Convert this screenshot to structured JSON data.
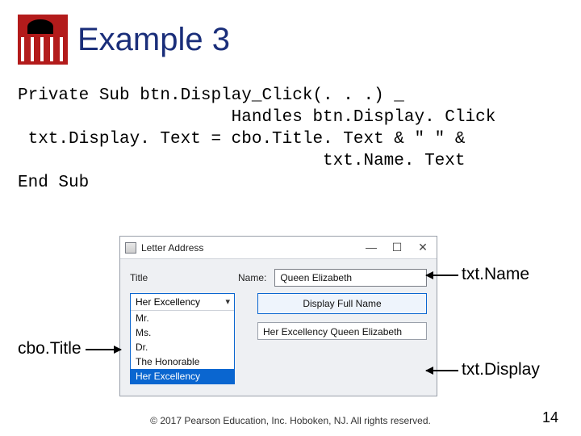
{
  "slide": {
    "title": "Example 3",
    "code": "Private Sub btn.Display_Click(. . .) _\n                     Handles btn.Display. Click\n txt.Display. Text = cbo.Title. Text & \" \" &\n                              txt.Name. Text\nEnd Sub"
  },
  "window": {
    "title": "Letter Address",
    "controls": {
      "min": "—",
      "max": "☐",
      "close": "✕"
    },
    "labels": {
      "title": "Title",
      "name": "Name:"
    },
    "name_value": "Queen Elizabeth",
    "combo": {
      "selected": "Her Excellency",
      "items": [
        "Mr.",
        "Ms.",
        "Dr.",
        "The Honorable",
        "Her Excellency"
      ],
      "selected_index": 4
    },
    "button": "Display Full Name",
    "output": "Her Excellency Queen Elizabeth"
  },
  "annotations": {
    "txtName": "txt.Name",
    "cboTitle": "cbo.Title",
    "txtDisplay": "txt.Display"
  },
  "footer": "© 2017 Pearson Education, Inc. Hoboken, NJ. All rights reserved.",
  "page": "14"
}
